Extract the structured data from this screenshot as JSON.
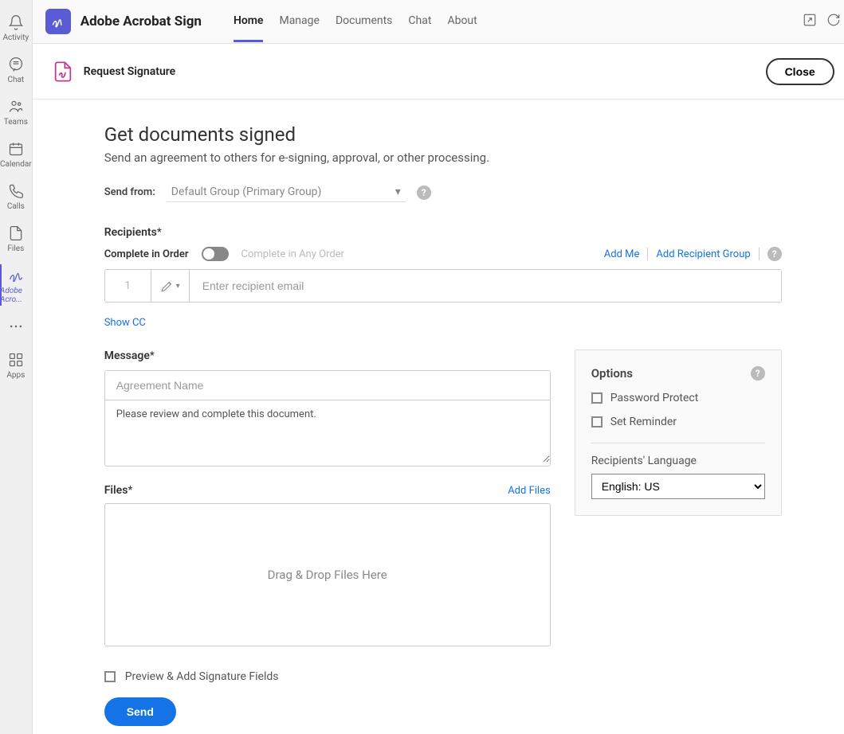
{
  "rail": {
    "items": [
      {
        "label": "Activity"
      },
      {
        "label": "Chat"
      },
      {
        "label": "Teams"
      },
      {
        "label": "Calendar"
      },
      {
        "label": "Calls"
      },
      {
        "label": "Files"
      },
      {
        "label": "Adobe Acro..."
      },
      {
        "label": ""
      },
      {
        "label": "Apps"
      }
    ]
  },
  "header": {
    "app_title": "Adobe Acrobat Sign",
    "tabs": [
      {
        "label": "Home"
      },
      {
        "label": "Manage"
      },
      {
        "label": "Documents"
      },
      {
        "label": "Chat"
      },
      {
        "label": "About"
      }
    ]
  },
  "subheader": {
    "title": "Request Signature",
    "close": "Close"
  },
  "page": {
    "title": "Get documents signed",
    "subtitle": "Send an agreement to others for e-signing, approval, or other processing."
  },
  "send_from": {
    "label": "Send from:",
    "value": "Default Group (Primary Group)"
  },
  "recipients": {
    "label": "Recipients",
    "required": "*",
    "order_on": "Complete in Order",
    "order_off": "Complete in Any Order",
    "add_me": "Add Me",
    "add_group": "Add Recipient Group",
    "row1_num": "1",
    "email_placeholder": "Enter recipient email",
    "show_cc": "Show CC"
  },
  "message": {
    "label": "Message",
    "required": "*",
    "name_placeholder": "Agreement Name",
    "body": "Please review and complete this document."
  },
  "files": {
    "label": "Files",
    "required": "*",
    "add": "Add Files",
    "drop": "Drag & Drop Files Here"
  },
  "options": {
    "title": "Options",
    "password": "Password Protect",
    "reminder": "Set Reminder",
    "lang_label": "Recipients' Language",
    "lang_value": "English: US"
  },
  "footer": {
    "preview": "Preview & Add Signature Fields",
    "send": "Send"
  }
}
